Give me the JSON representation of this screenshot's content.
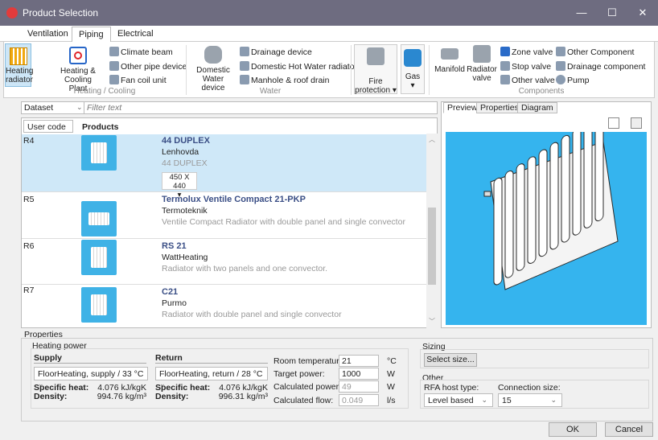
{
  "window": {
    "title": "Product Selection",
    "minimize": "—",
    "maximize": "☐",
    "close": "✕"
  },
  "tabs": [
    "Ventilation",
    "Piping",
    "Electrical"
  ],
  "ribbon": {
    "heating_radiator": "Heating radiator",
    "heating_cooling_plant": "Heating & Cooling Plant",
    "climate_beam": "Climate beam",
    "other_pipe_device": "Other pipe device",
    "fan_coil_unit": "Fan coil unit",
    "group_heating": "Heating / Cooling",
    "domestic_water_device": "Domestic Water device",
    "drainage_device": "Drainage device",
    "domestic_hot_water_radiator": "Domestic Hot Water radiator",
    "manhole_roof_drain": "Manhole & roof drain",
    "group_water": "Water",
    "fire_protection": "Fire protection ▾",
    "gas": "Gas",
    "gas_arrow": "▾",
    "manifold": "Manifold",
    "radiator_valve": "Radiator valve",
    "zone_valve": "Zone valve",
    "stop_valve": "Stop valve",
    "other_valve": "Other valve",
    "other_component": "Other Component",
    "drainage_component": "Drainage component",
    "pump": "Pump",
    "group_components": "Components"
  },
  "filter": {
    "dataset": "Dataset",
    "placeholder": "Filter text"
  },
  "list_header": {
    "user_code": "User code",
    "products": "Products"
  },
  "products": [
    {
      "code": "R4",
      "name": "44 DUPLEX",
      "maker": "Lenhovda",
      "desc": "44 DUPLEX",
      "size": "450 X 440"
    },
    {
      "code": "R5",
      "name": "Termolux Ventile Compact 21-PKP",
      "maker": "Termoteknik",
      "desc": "Ventile Compact Radiator with double panel and single convector"
    },
    {
      "code": "R6",
      "name": "RS 21",
      "maker": "WattHeating",
      "desc": "Radiator with two panels and one convector."
    },
    {
      "code": "R7",
      "name": "C21",
      "maker": "Purmo",
      "desc": "Radiator with double panel and single convector"
    }
  ],
  "preview_tabs": [
    "Preview",
    "Properties",
    "Diagram"
  ],
  "properties": {
    "title": "Properties",
    "heating_power": "Heating power",
    "supply": "Supply",
    "return": "Return",
    "supply_select": "FloorHeating, supply / 33 °C",
    "return_select": "FloorHeating, return / 28 °C",
    "specific_heat_label": "Specific heat:",
    "density_label": "Density:",
    "supply_specific_heat": "4.076 kJ/kgK",
    "supply_density": "994.76 kg/m³",
    "return_specific_heat": "4.076 kJ/kgK",
    "return_density": "996.31 kg/m³",
    "room_temp_label": "Room temperature:",
    "room_temp": "21",
    "room_temp_unit": "°C",
    "target_power_label": "Target power:",
    "target_power": "1000",
    "target_power_unit": "W",
    "calc_power_label": "Calculated power:",
    "calc_power": "49",
    "calc_power_unit": "W",
    "calc_flow_label": "Calculated flow:",
    "calc_flow": "0.049",
    "calc_flow_unit": "l/s",
    "sizing": "Sizing",
    "select_size": "Select size...",
    "other": "Other",
    "rfa_host_label": "RFA host type:",
    "rfa_host": "Level based",
    "connection_size_label": "Connection size:",
    "connection_size": "15"
  },
  "buttons": {
    "ok": "OK",
    "cancel": "Cancel"
  },
  "colors": {
    "titlebar": "#6e6c80",
    "preview_bg": "#35b4ee",
    "selected_row": "#cfe8f8",
    "product_name": "#3b4f86"
  }
}
